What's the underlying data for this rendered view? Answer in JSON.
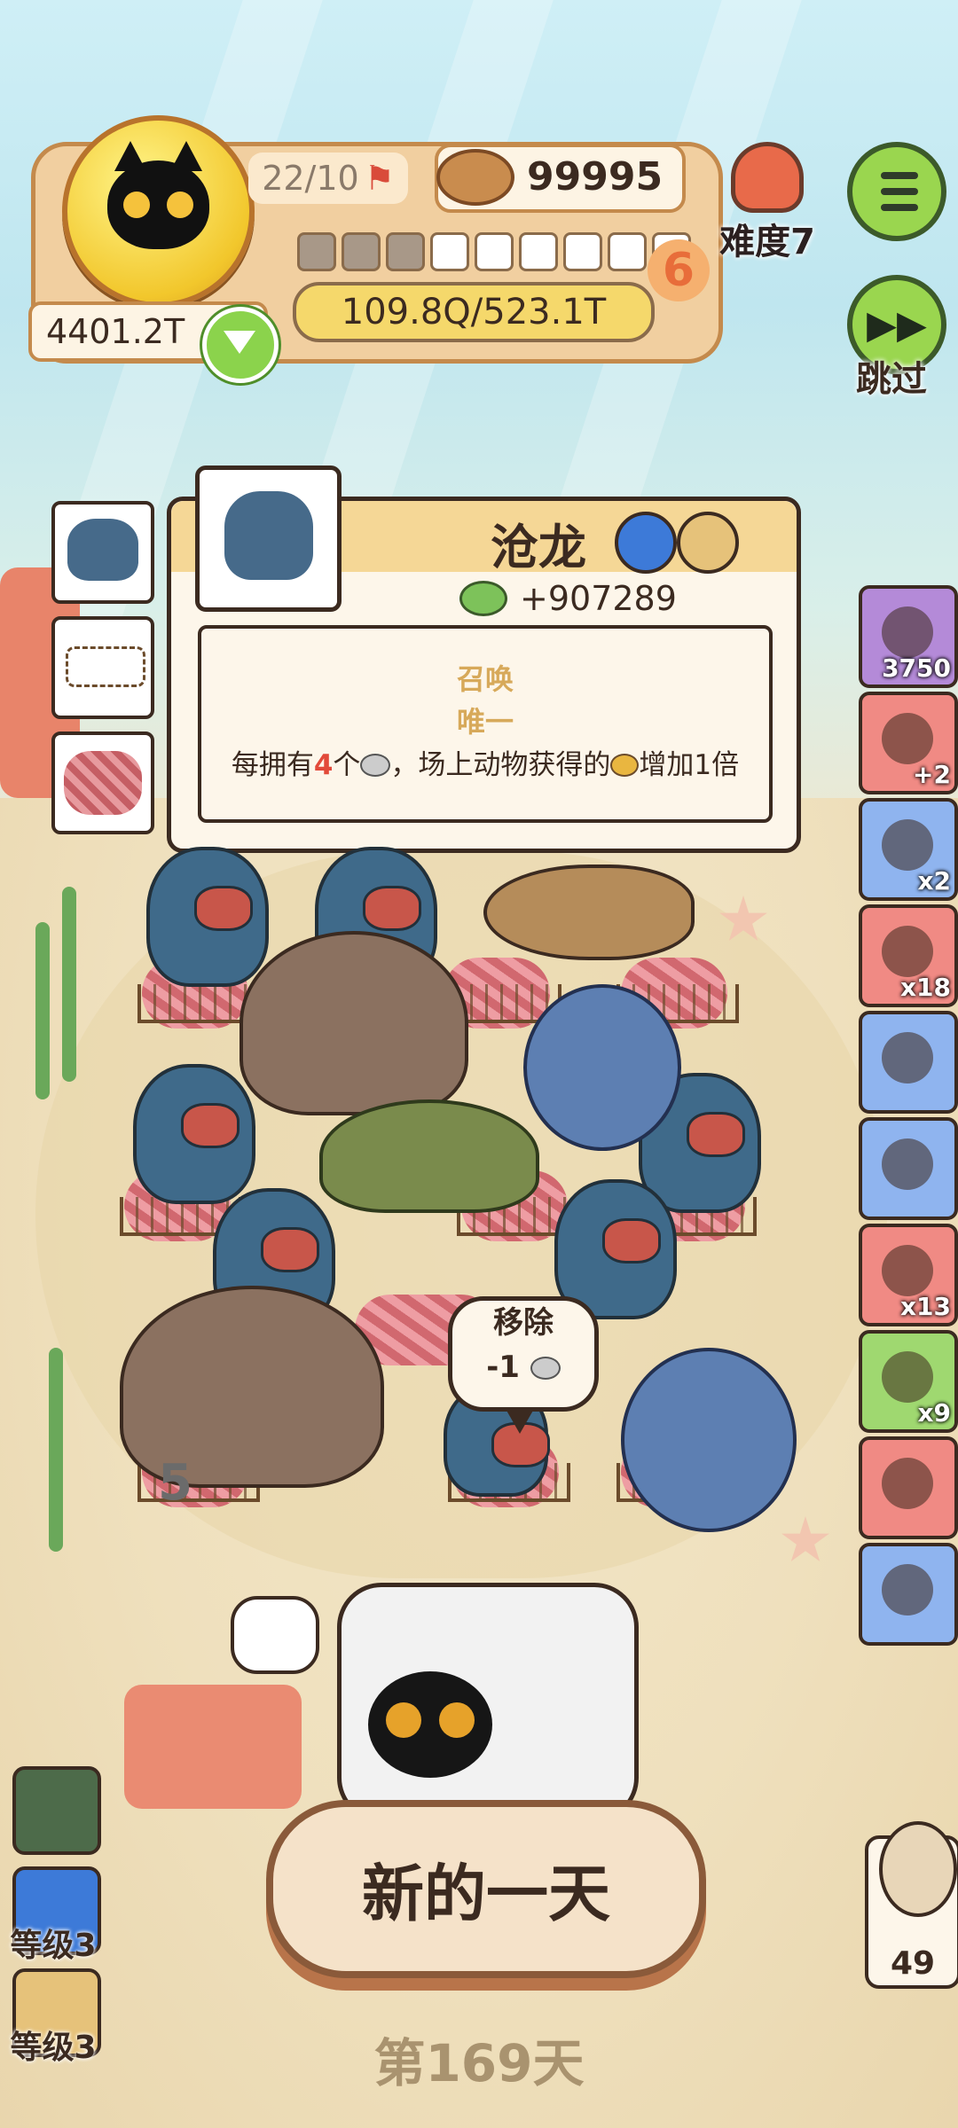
{
  "hud": {
    "level": "22/10",
    "coins": "99995",
    "food_total": "4401.2T",
    "progress": "109.8Q/523.1T",
    "segments_filled": 3,
    "segments_total": 9,
    "segment_count": "6",
    "difficulty": "难度7",
    "skip": "跳过"
  },
  "card": {
    "title": "沧龙",
    "stat": "+907289",
    "keyword1": "召唤",
    "keyword2": "唯一",
    "desc_pre": "每拥有",
    "desc_num": "4",
    "desc_mid": "个",
    "desc_post1": "，场上动物获得的",
    "desc_post2": "增加1倍"
  },
  "items": [
    {
      "count": "3750",
      "color": "#b48ad8"
    },
    {
      "count": "+2",
      "color": "#f08a84"
    },
    {
      "count": "x2",
      "color": "#8fb4ef"
    },
    {
      "count": "x18",
      "color": "#f08a84"
    },
    {
      "count": "",
      "color": "#8fb4ef"
    },
    {
      "count": "",
      "color": "#8fb4ef"
    },
    {
      "count": "x13",
      "color": "#f08a84"
    },
    {
      "count": "x9",
      "color": "#9fd870"
    },
    {
      "count": "",
      "color": "#f08a84"
    },
    {
      "count": "",
      "color": "#8fb4ef"
    }
  ],
  "field": {
    "remove_label": "移除",
    "remove_cost": "-1",
    "slot_number": "5"
  },
  "bottom": {
    "new_day": "新的一天",
    "day": "第169天",
    "level1": "等级3",
    "level2": "等级3",
    "counter": "49"
  }
}
